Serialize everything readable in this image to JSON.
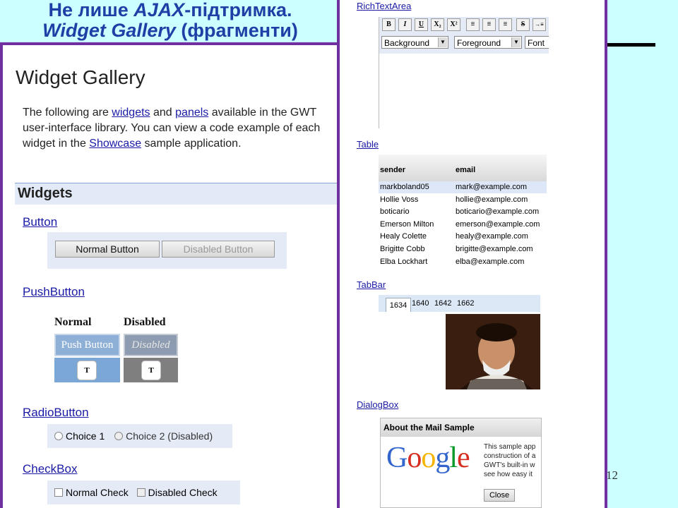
{
  "slide": {
    "title_line1_a": "Не лише ",
    "title_line1_b": "AJAX",
    "title_line1_c": "-підтримка.",
    "title_line2_a": "Widget Gallery",
    "title_line2_b": " (фрагменти)",
    "page_number": "12"
  },
  "gallery": {
    "heading": "Widget Gallery",
    "intro_1": "The following are ",
    "intro_link_widgets": "widgets",
    "intro_2": " and ",
    "intro_link_panels": "panels",
    "intro_3": " available in the GWT user-interface library. You can view a code example of each widget in the ",
    "intro_link_showcase": "Showcase",
    "intro_4": " sample application.",
    "section_heading": "Widgets"
  },
  "button_widget": {
    "title": "Button",
    "normal_label": "Normal Button",
    "disabled_label": "Disabled Button"
  },
  "pushbutton_widget": {
    "title": "PushButton",
    "col_normal": "Normal",
    "col_disabled": "Disabled",
    "push_label": "Push Button",
    "disabled_label": "Disabled",
    "icon_text": "T"
  },
  "radiobutton_widget": {
    "title": "RadioButton",
    "choice1": "Choice 1",
    "choice2": "Choice 2 (Disabled)"
  },
  "checkbox_widget": {
    "title": "CheckBox",
    "normal": "Normal Check",
    "disabled": "Disabled Check"
  },
  "richtext_widget": {
    "title": "RichTextArea",
    "toolbar": [
      "B",
      "I",
      "U",
      "X₂",
      "X²",
      "≡",
      "≡",
      "≡",
      "S",
      "→≡"
    ],
    "sel_background": "Background",
    "sel_foreground": "Foreground",
    "sel_font": "Font"
  },
  "table_widget": {
    "title": "Table",
    "col_sender": "sender",
    "col_email": "email",
    "rows": [
      [
        "markboland05",
        "mark@example.com"
      ],
      [
        "Hollie Voss",
        "hollie@example.com"
      ],
      [
        "boticario",
        "boticario@example.com"
      ],
      [
        "Emerson Milton",
        "emerson@example.com"
      ],
      [
        "Healy Colette",
        "healy@example.com"
      ],
      [
        "Brigitte Cobb",
        "brigitte@example.com"
      ],
      [
        "Elba Lockhart",
        "elba@example.com"
      ]
    ]
  },
  "tabbar_widget": {
    "title": "TabBar",
    "tabs": [
      "1634",
      "1640",
      "1642",
      "1662"
    ]
  },
  "dialog_widget": {
    "title": "DialogBox",
    "caption": "About the Mail Sample",
    "logo_text": "Google",
    "body_lines": [
      "This sample app",
      "construction of a",
      "GWT's built-in w",
      "see how easy it"
    ],
    "close_label": "Close"
  },
  "colors": {
    "border": "#7030a0",
    "title": "#1f3fa6",
    "link": "#1a1aa6",
    "slide_bg": "#ccffff"
  }
}
